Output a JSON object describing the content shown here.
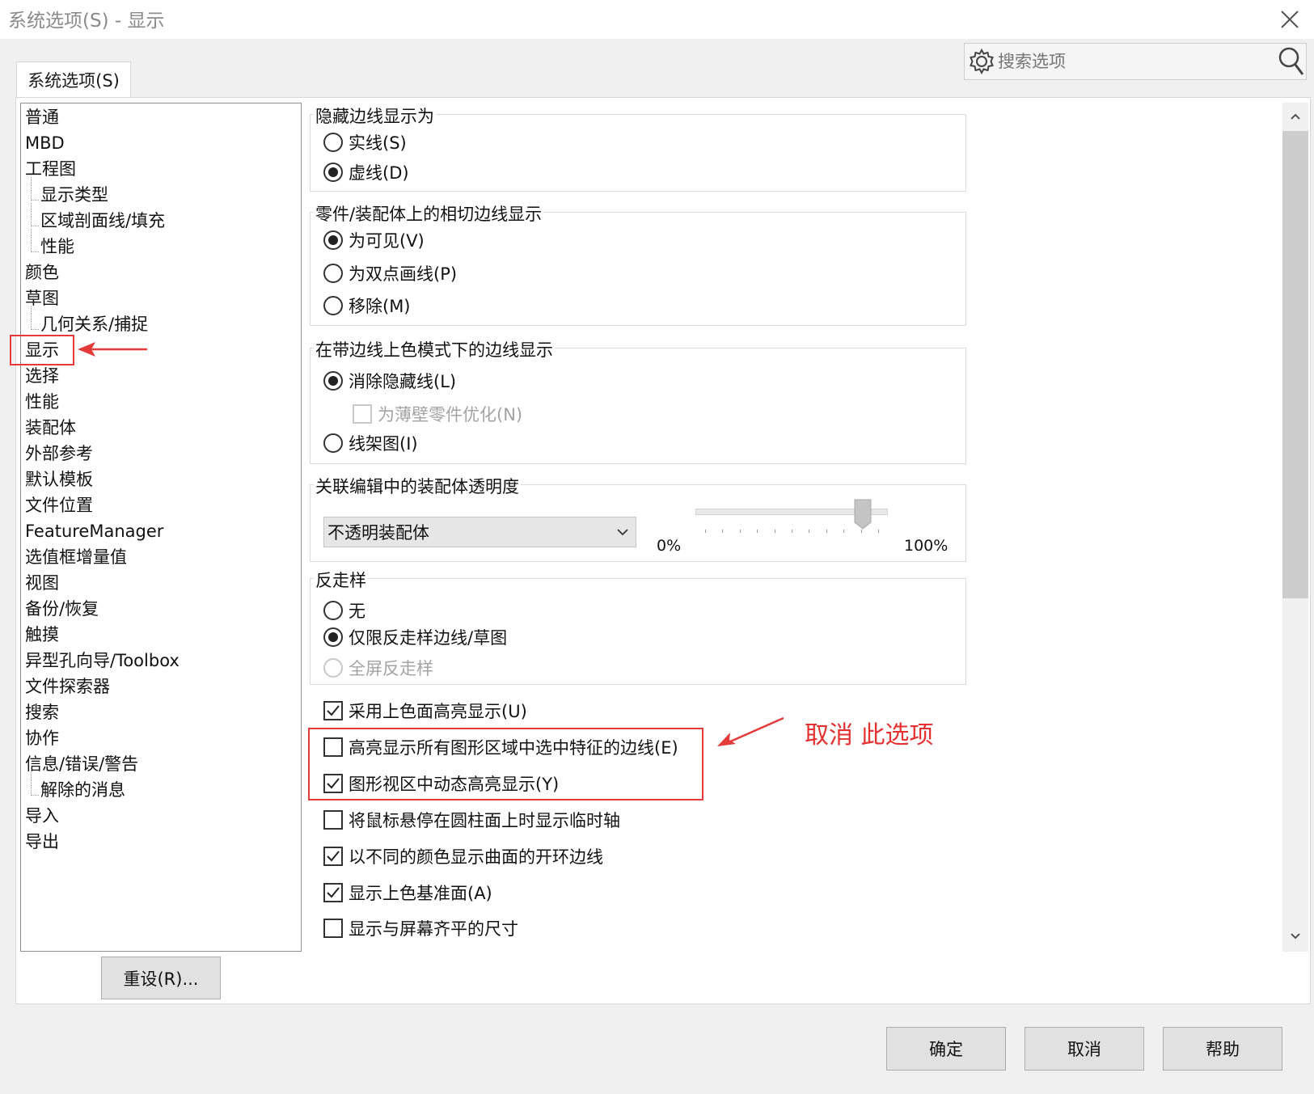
{
  "window": {
    "title": "系统选项(S) - 显示"
  },
  "tabs": [
    {
      "label": "系统选项(S)"
    }
  ],
  "search": {
    "placeholder": "搜索选项"
  },
  "tree": {
    "items": [
      {
        "label": "普通",
        "indent": 0
      },
      {
        "label": "MBD",
        "indent": 0
      },
      {
        "label": "工程图",
        "indent": 0
      },
      {
        "label": "显示类型",
        "indent": 1
      },
      {
        "label": "区域剖面线/填充",
        "indent": 1
      },
      {
        "label": "性能",
        "indent": 1
      },
      {
        "label": "颜色",
        "indent": 0
      },
      {
        "label": "草图",
        "indent": 0
      },
      {
        "label": "几何关系/捕捉",
        "indent": 1
      },
      {
        "label": "显示",
        "indent": 0,
        "selected": true
      },
      {
        "label": "选择",
        "indent": 0
      },
      {
        "label": "性能",
        "indent": 0
      },
      {
        "label": "装配体",
        "indent": 0
      },
      {
        "label": "外部参考",
        "indent": 0
      },
      {
        "label": "默认模板",
        "indent": 0
      },
      {
        "label": "文件位置",
        "indent": 0
      },
      {
        "label": "FeatureManager",
        "indent": 0
      },
      {
        "label": "选值框增量值",
        "indent": 0
      },
      {
        "label": "视图",
        "indent": 0
      },
      {
        "label": "备份/恢复",
        "indent": 0
      },
      {
        "label": "触摸",
        "indent": 0
      },
      {
        "label": "异型孔向导/Toolbox",
        "indent": 0
      },
      {
        "label": "文件探索器",
        "indent": 0
      },
      {
        "label": "搜索",
        "indent": 0
      },
      {
        "label": "协作",
        "indent": 0
      },
      {
        "label": "信息/错误/警告",
        "indent": 0
      },
      {
        "label": "解除的消息",
        "indent": 1
      },
      {
        "label": "导入",
        "indent": 0
      },
      {
        "label": "导出",
        "indent": 0
      }
    ]
  },
  "groups": {
    "hidden_edges": {
      "title": "隐藏边线显示为",
      "options": [
        {
          "label": "实线(S)",
          "checked": false
        },
        {
          "label": "虚线(D)",
          "checked": true
        }
      ]
    },
    "tangent_edges": {
      "title": "零件/装配体上的相切边线显示",
      "options": [
        {
          "label": "为可见(V)",
          "checked": true
        },
        {
          "label": "为双点画线(P)",
          "checked": false
        },
        {
          "label": "移除(M)",
          "checked": false
        }
      ]
    },
    "shaded_edges": {
      "title": "在带边线上色模式下的边线显示",
      "options": [
        {
          "label": "消除隐藏线(L)",
          "checked": true
        },
        {
          "label": "线架图(I)",
          "checked": false
        }
      ],
      "sub_check": {
        "label": "为薄壁零件优化(N)",
        "checked": false,
        "disabled": true
      }
    },
    "transparency": {
      "title": "关联编辑中的装配体透明度",
      "combo_value": "不透明装配体",
      "min_label": "0%",
      "max_label": "100%",
      "slider_value_percent": 86
    },
    "antialias": {
      "title": "反走样",
      "options": [
        {
          "label": "无",
          "checked": false
        },
        {
          "label": "仅限反走样边线/草图",
          "checked": true
        },
        {
          "label": "全屏反走样",
          "checked": false,
          "disabled": true
        }
      ]
    }
  },
  "checkboxes": [
    {
      "label": "采用上色面高亮显示(U)",
      "checked": true
    },
    {
      "label": "高亮显示所有图形区域中选中特征的边线(E)",
      "checked": false
    },
    {
      "label": "图形视区中动态高亮显示(Y)",
      "checked": true
    },
    {
      "label": "将鼠标悬停在圆柱面上时显示临时轴",
      "checked": false
    },
    {
      "label": "以不同的颜色显示曲面的开环边线",
      "checked": true
    },
    {
      "label": "显示上色基准面(A)",
      "checked": true
    },
    {
      "label": "显示与屏幕齐平的尺寸",
      "checked": false
    }
  ],
  "annotation": {
    "note": "取消 此选项",
    "color": "#e53030"
  },
  "buttons": {
    "reset": "重设(R)...",
    "ok": "确定",
    "cancel": "取消",
    "help": "帮助"
  }
}
